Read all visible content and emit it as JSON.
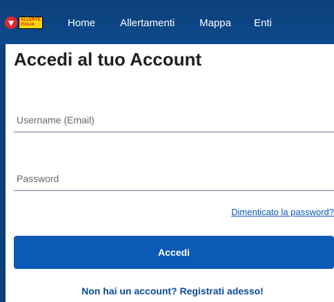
{
  "brand": {
    "logo_line1": "ALLERTE",
    "logo_line2": "ITALIA",
    "logo_mark_icon": "alert-triangle-icon",
    "color_primary": "#0b3f7a",
    "color_accent": "#ffd500",
    "color_logo_red": "#e0262b"
  },
  "nav": {
    "items": [
      {
        "label": "Home"
      },
      {
        "label": "Allertamenti"
      },
      {
        "label": "Mappa"
      },
      {
        "label": "Enti"
      }
    ]
  },
  "login": {
    "title": "Accedi al tuo Account",
    "email_placeholder": "Username (Email)",
    "email_value": "",
    "password_placeholder": "Password",
    "password_value": "",
    "forgot_link": "Dimenticato la password?",
    "submit_label": "Accedi",
    "register_link": "Non hai un account? Registrati adesso!",
    "color_button": "#0b5ab5"
  }
}
